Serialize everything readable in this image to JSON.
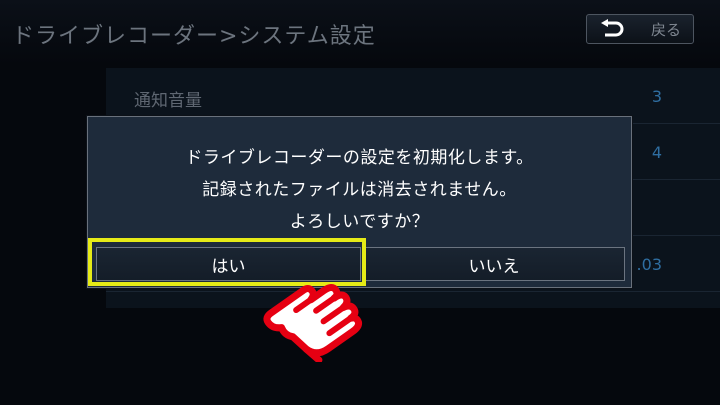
{
  "header": {
    "title": "ドライブレコーダー>システム設定",
    "back_label": "戻る"
  },
  "settings": {
    "rows": [
      {
        "label": "通知音量",
        "value": "3"
      },
      {
        "label": "",
        "value": "4"
      },
      {
        "label": "",
        "value": ""
      },
      {
        "label": "",
        "value": ".03"
      }
    ]
  },
  "dialog": {
    "line1": "ドライブレコーダーの設定を初期化します。",
    "line2": "記録されたファイルは消去されません。",
    "line3": "よろしいですか？",
    "yes_label": "はい",
    "no_label": "いいえ"
  },
  "colors": {
    "highlight": "#e6eb17",
    "hand": "#e60012",
    "dialog_bg": "#1e2b3b"
  },
  "icons": {
    "back": "u-turn-arrow-icon",
    "pointer": "pointing-hand-icon"
  }
}
